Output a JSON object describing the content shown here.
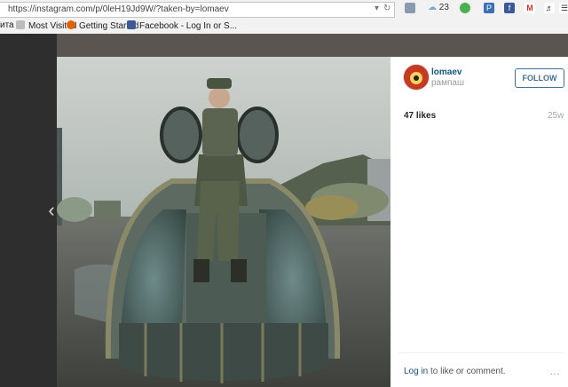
{
  "browser": {
    "url": "https://instagram.com/p/0leH19Jd9W/?taken-by=lomaev",
    "weather_count": "23",
    "bookmarks": [
      "Most Visited",
      "Getting Started",
      "Facebook - Log In or S..."
    ],
    "bookmark_cut": "ита"
  },
  "post": {
    "username": "lomaev",
    "location": "рампаш",
    "follow_label": "FOLLOW",
    "likes": "47 likes",
    "age": "25w",
    "login_link": "Log in",
    "login_rest": " to like or comment.",
    "more": "…"
  },
  "colors": {
    "link": "#125688",
    "follow": "#3f729b"
  }
}
